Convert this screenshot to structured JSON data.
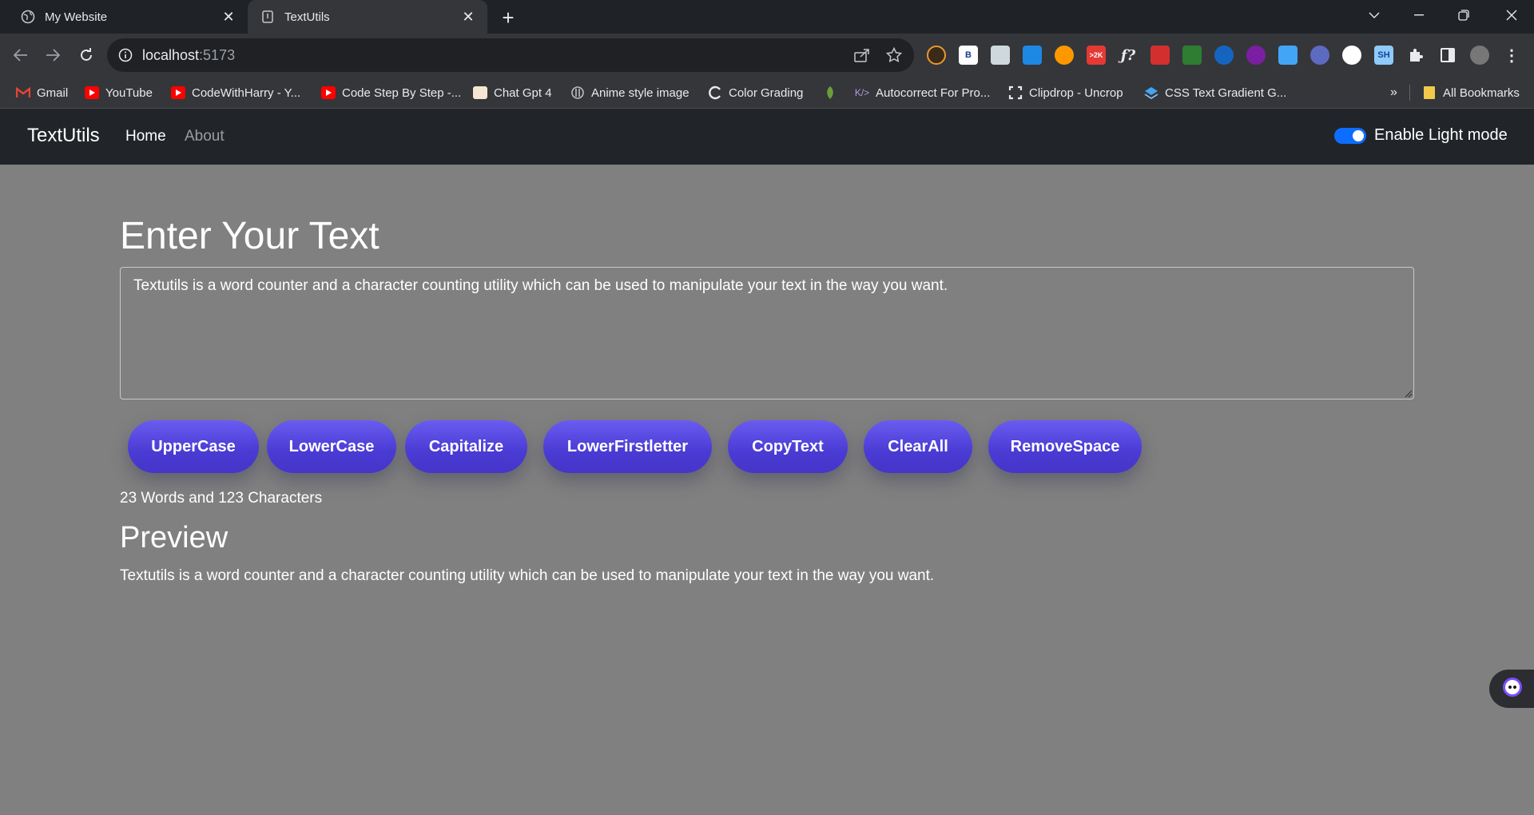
{
  "browser": {
    "tabs": [
      {
        "title": "My Website",
        "active": false
      },
      {
        "title": "TextUtils",
        "active": true
      }
    ],
    "url_host": "localhost",
    "url_port": ":5173",
    "extensions": [
      "extension-1",
      "extension-2",
      "extension-3",
      "extension-4",
      "extension-5",
      "extension-6",
      "extension-7",
      "extension-8",
      "extension-9",
      "extension-10",
      "extension-11",
      "extension-12",
      "extension-13",
      "extension-14",
      "extension-15",
      "extension-16"
    ],
    "extension_badge": ">2K",
    "bookmarks": [
      {
        "label": "Gmail",
        "icon": "gmail-icon"
      },
      {
        "label": "YouTube",
        "icon": "youtube-icon"
      },
      {
        "label": "CodeWithHarry - Y...",
        "icon": "youtube-icon"
      },
      {
        "label": "Code Step By Step -...",
        "icon": "youtube-icon"
      },
      {
        "label": "Chat Gpt 4",
        "icon": "chatgpt-icon"
      },
      {
        "label": "Anime style image",
        "icon": "anime-icon"
      },
      {
        "label": "Color Grading",
        "icon": "color-grading-icon"
      },
      {
        "label": "",
        "icon": "leaf-icon"
      },
      {
        "label": "Autocorrect For Pro...",
        "icon": "code-icon"
      },
      {
        "label": "Clipdrop - Uncrop",
        "icon": "clipdrop-icon"
      },
      {
        "label": "CSS Text Gradient G...",
        "icon": "css-gradient-icon"
      }
    ],
    "bookmarks_overflow": "»",
    "all_bookmarks": "All Bookmarks"
  },
  "app": {
    "brand": "TextUtils",
    "nav": [
      {
        "label": "Home",
        "active": true
      },
      {
        "label": "About",
        "active": false
      }
    ],
    "mode_toggle_label": "Enable Light mode",
    "mode_toggle_on": true,
    "heading": "Enter Your Text",
    "textarea_value": "Textutils is a word counter and a character counting utility which can be used to manipulate your text in the way you want.",
    "buttons": [
      "UpperCase",
      "LowerCase",
      "Capitalize",
      "LowerFirstletter",
      "CopyText",
      "ClearAll",
      "RemoveSpace"
    ],
    "summary": "23 Words and 123 Characters",
    "preview_heading": "Preview",
    "preview_text": "Textutils is a word counter and a character counting utility which can be used to manipulate your text in the way you want."
  },
  "colors": {
    "page_bg": "#808080",
    "navbar_bg": "#212529",
    "button_gradient_top": "#6a5cf0",
    "button_gradient_bottom": "#4535c8",
    "toggle_on": "#0d6efd"
  }
}
